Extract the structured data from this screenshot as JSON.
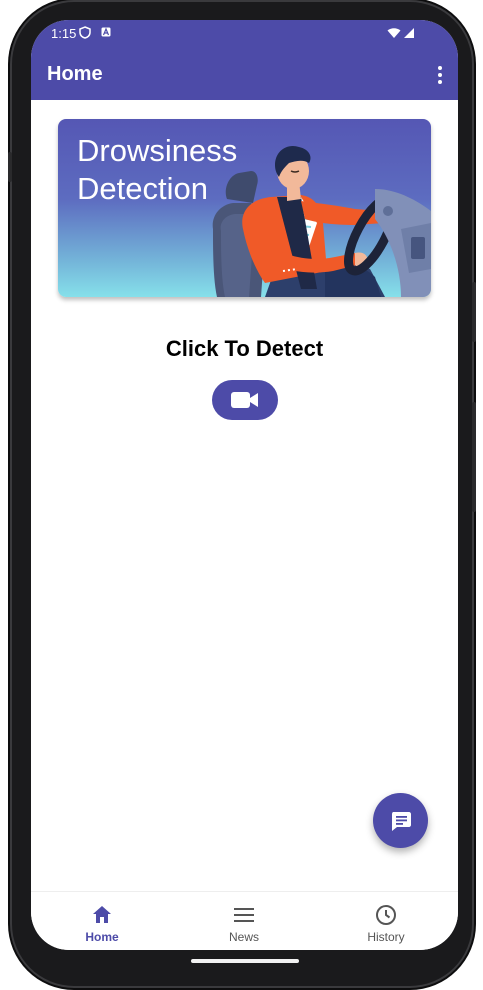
{
  "status_bar": {
    "time": "1:15",
    "icons": [
      "shield-icon",
      "keyboard-a-icon",
      "wifi-icon",
      "signal-icon"
    ]
  },
  "app_bar": {
    "title": "Home",
    "menu_icon": "more-vert-icon"
  },
  "banner": {
    "title": "Drowsiness\nDetection",
    "illustration": "sleepy-driver-illustration"
  },
  "main": {
    "detect_label": "Click To Detect",
    "detect_button_icon": "video-camera-icon"
  },
  "fab": {
    "icon": "chat-icon"
  },
  "bottom_nav": {
    "items": [
      {
        "label": "Home",
        "icon": "home-icon",
        "active": true
      },
      {
        "label": "News",
        "icon": "menu-lines-icon",
        "active": false
      },
      {
        "label": "History",
        "icon": "clock-icon",
        "active": false
      }
    ]
  },
  "colors": {
    "primary": "#4d4ba8",
    "active_nav": "#4d4ba8",
    "inactive_nav": "#555555"
  }
}
